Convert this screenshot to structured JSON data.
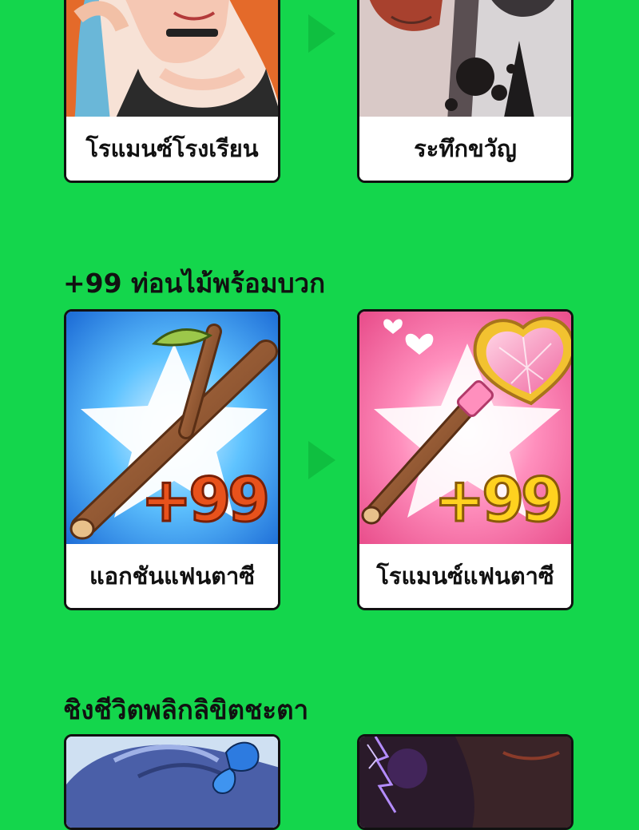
{
  "colors": {
    "background": "#14d64c",
    "arrow": "#0fbf40",
    "card_border": "#111111",
    "badge_orange": "#e8521c",
    "badge_yellow": "#ffd21f"
  },
  "rows": [
    {
      "title": "",
      "from": {
        "caption": "โรแมนซ์โรงเรียน",
        "art": "school-romance-girl-illustration"
      },
      "to": {
        "caption": "ระทึกขวัญ",
        "art": "thriller-couple-illustration"
      }
    },
    {
      "title": "+99 ท่อนไม้พร้อมบวก",
      "from": {
        "caption": "แอกชันแฟนตาซี",
        "art": "wooden-stick-icon",
        "badge": "+99"
      },
      "to": {
        "caption": "โรแมนซ์แฟนตาซี",
        "art": "heart-gem-wand-icon",
        "badge": "+99"
      }
    },
    {
      "title": "ชิงชีวิตพลิกลิขิตชะตา",
      "from": {
        "art": "blue-hair-butterfly-illustration"
      },
      "to": {
        "art": "dark-lightning-illustration"
      }
    }
  ]
}
